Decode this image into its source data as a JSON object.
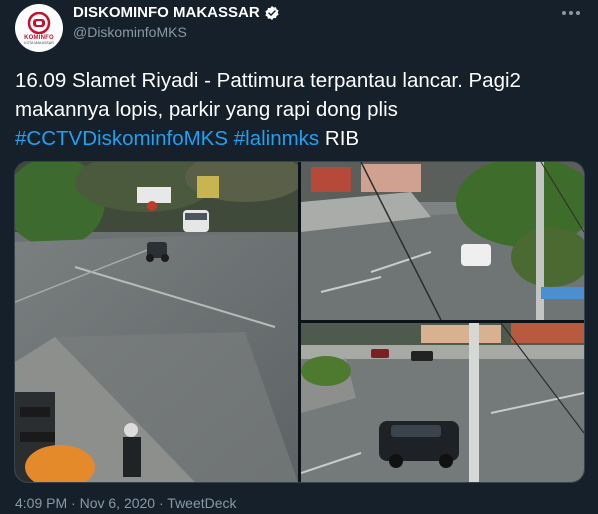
{
  "author": {
    "display_name": "DISKOMINFO MAKASSAR",
    "handle": "@DiskominfoMKS",
    "verified": true,
    "avatar_logo_text": "KOMINFO",
    "avatar_logo_subtext": "KOTA MAKASSAR"
  },
  "tweet": {
    "text_plain_1": "16.09 Slamet Riyadi - Pattimura terpantau lancar. Pagi2 makannya lopis, parkir yang rapi dong plis",
    "hashtag_1": "#CCTVDiskominfoMKS",
    "hashtag_2": "#lalinmks",
    "text_plain_2": "RIB"
  },
  "media": {
    "photos": [
      {
        "name": "cctv-intersection-left"
      },
      {
        "name": "cctv-intersection-top-right"
      },
      {
        "name": "cctv-intersection-bottom-right"
      }
    ]
  },
  "footer": {
    "time": "4:09 PM",
    "date": "Nov 6, 2020",
    "source": "TweetDeck",
    "separator": " · "
  },
  "colors": {
    "background": "#15202b",
    "text": "#ffffff",
    "secondary": "#8899a6",
    "link": "#1da1f2",
    "verified": "#ffffff"
  }
}
